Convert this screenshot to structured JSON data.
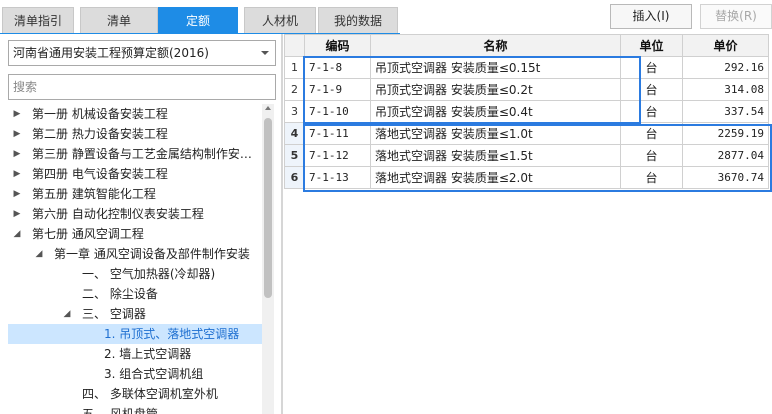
{
  "tabs": [
    {
      "label": "清单指引",
      "active": false
    },
    {
      "label": "清单",
      "active": false
    },
    {
      "label": "定额",
      "active": true
    },
    {
      "label": "人材机",
      "active": false
    },
    {
      "label": "我的数据",
      "active": false
    }
  ],
  "toolbar": {
    "insert_label": "插入(I)",
    "replace_label": "替换(R)"
  },
  "library_select": {
    "value": "河南省通用安装工程预算定额(2016)"
  },
  "search": {
    "placeholder": "搜索",
    "value": ""
  },
  "tree": [
    {
      "label": "第一册 机械设备安装工程",
      "level": 0,
      "arrow": "collapsed"
    },
    {
      "label": "第二册 热力设备安装工程",
      "level": 0,
      "arrow": "collapsed"
    },
    {
      "label": "第三册 静置设备与工艺金属结构制作安…",
      "level": 0,
      "arrow": "collapsed"
    },
    {
      "label": "第四册 电气设备安装工程",
      "level": 0,
      "arrow": "collapsed"
    },
    {
      "label": "第五册 建筑智能化工程",
      "level": 0,
      "arrow": "collapsed"
    },
    {
      "label": "第六册 自动化控制仪表安装工程",
      "level": 0,
      "arrow": "collapsed"
    },
    {
      "label": "第七册 通风空调工程",
      "level": 0,
      "arrow": "expanded"
    },
    {
      "label": "第一章 通风空调设备及部件制作安装",
      "level": 1,
      "arrow": "expanded"
    },
    {
      "label": "一、 空气加热器(冷却器)",
      "level": 2,
      "arrow": "none"
    },
    {
      "label": "二、 除尘设备",
      "level": 2,
      "arrow": "none"
    },
    {
      "label": "三、 空调器",
      "level": 2,
      "arrow": "expanded"
    },
    {
      "label": "1. 吊顶式、落地式空调器",
      "level": 3,
      "arrow": "none",
      "selected": true
    },
    {
      "label": "2. 墙上式空调器",
      "level": 3,
      "arrow": "none"
    },
    {
      "label": "3. 组合式空调机组",
      "level": 3,
      "arrow": "none"
    },
    {
      "label": "四、 多联体空调机室外机",
      "level": 2,
      "arrow": "none"
    },
    {
      "label": "五、 风机盘管",
      "level": 2,
      "arrow": "none"
    }
  ],
  "grid": {
    "headers": {
      "code": "编码",
      "name": "名称",
      "unit": "单位",
      "price": "单价"
    },
    "rows": [
      {
        "num": "1",
        "code": "7-1-8",
        "name": "吊顶式空调器 安装质量≤0.15t",
        "unit": "台",
        "price": "292.16"
      },
      {
        "num": "2",
        "code": "7-1-9",
        "name": "吊顶式空调器 安装质量≤0.2t",
        "unit": "台",
        "price": "314.08"
      },
      {
        "num": "3",
        "code": "7-1-10",
        "name": "吊顶式空调器 安装质量≤0.4t",
        "unit": "台",
        "price": "337.54"
      },
      {
        "num": "4",
        "code": "7-1-11",
        "name": "落地式空调器 安装质量≤1.0t",
        "unit": "台",
        "price": "2259.19"
      },
      {
        "num": "5",
        "code": "7-1-12",
        "name": "落地式空调器 安装质量≤1.5t",
        "unit": "台",
        "price": "2877.04"
      },
      {
        "num": "6",
        "code": "7-1-13",
        "name": "落地式空调器 安装质量≤2.0t",
        "unit": "台",
        "price": "3670.74"
      }
    ]
  },
  "colors": {
    "accent": "#1e8ce6",
    "selection": "#cce6ff",
    "selection_border": "#2b7be0"
  }
}
